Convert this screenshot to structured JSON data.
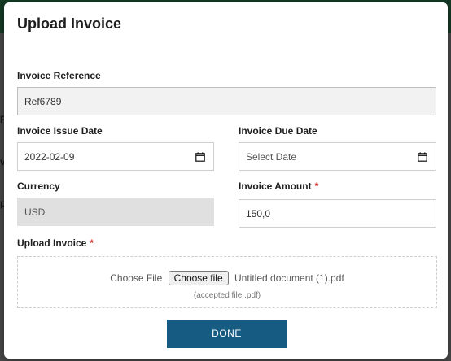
{
  "modal": {
    "title": "Upload Invoice"
  },
  "fields": {
    "reference_label": "Invoice Reference",
    "reference_value": "Ref6789",
    "issue_date_label": "Invoice Issue Date",
    "issue_date_value": "2022-02-09",
    "due_date_label": "Invoice Due Date",
    "due_date_placeholder": "Select Date",
    "currency_label": "Currency",
    "currency_value": "USD",
    "amount_label": "Invoice Amount",
    "amount_value": "150,0",
    "required_marker": "*"
  },
  "upload": {
    "label": "Upload Invoice",
    "choose_file_label": "Choose File",
    "choose_file_button": "Choose file",
    "file_name": "Untitled document (1).pdf",
    "accepted": "(accepted file .pdf)"
  },
  "actions": {
    "done_label": "DONE"
  },
  "icons": {
    "calendar": "calendar-icon"
  },
  "colors": {
    "accent": "#165c82",
    "required": "#d9342b"
  }
}
